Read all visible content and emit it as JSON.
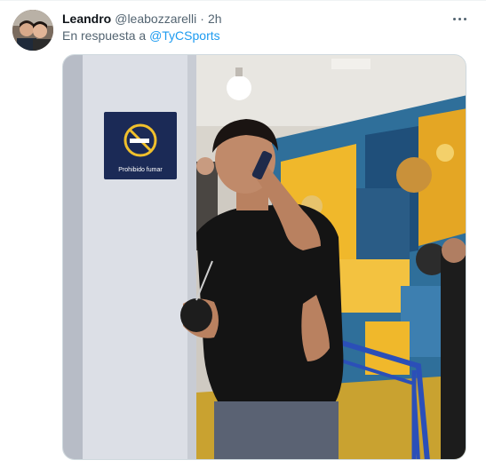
{
  "tweet": {
    "author_name": "Leandro",
    "author_handle": "@leabozzarelli",
    "separator": "·",
    "time": "2h",
    "reply_prefix": "En respuesta a",
    "reply_to": "@TyCSports"
  },
  "media": {
    "sign_text": "Prohibido fumar"
  },
  "colors": {
    "link": "#1d9bf0",
    "secondary_text": "#536471",
    "primary_text": "#0f1419"
  },
  "icons": {
    "more": "more-horizontal-icon"
  }
}
